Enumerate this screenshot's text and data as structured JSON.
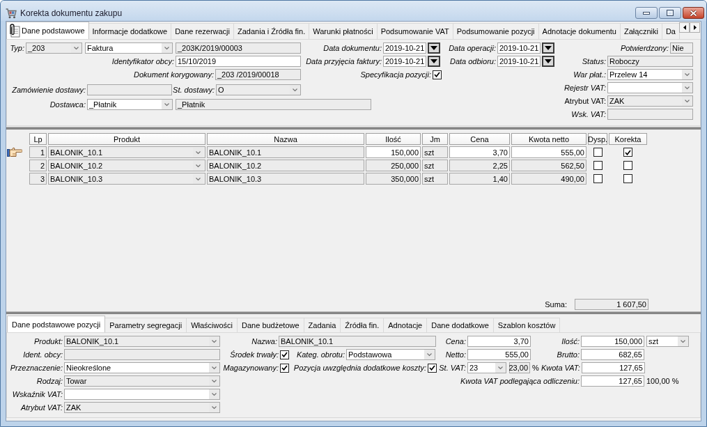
{
  "window": {
    "title": "Korekta dokumentu zakupu"
  },
  "tabs": [
    {
      "label": "Dane podstawowe",
      "selected": true
    },
    {
      "label": "Informacje dodatkowe",
      "selected": false
    },
    {
      "label": "Dane rezerwacji",
      "selected": false
    },
    {
      "label": "Zadania i Źródła fin.",
      "selected": false
    },
    {
      "label": "Warunki płatności",
      "selected": false
    },
    {
      "label": "Podsumowanie VAT",
      "selected": false
    },
    {
      "label": "Podsumowanie pozycji",
      "selected": false
    },
    {
      "label": "Adnotacje dokumentu",
      "selected": false
    },
    {
      "label": "Załączniki",
      "selected": false
    },
    {
      "label": "Da",
      "selected": false
    }
  ],
  "header": {
    "left": [
      [
        {
          "label": "Typ:",
          "italic": true,
          "kind": "combo",
          "value": "_203",
          "read_only": true
        },
        {
          "kind": "combo",
          "value": "Faktura",
          "read_only": false
        },
        {
          "kind": "text",
          "value": "_203K/2019/00003",
          "read_only": true
        }
      ],
      [
        {
          "label": "Identyfikator obcy:",
          "italic": true,
          "kind": "text",
          "value": "15/10/2019",
          "read_only": false
        }
      ],
      [
        {
          "label": "Dokument korygowany:",
          "italic": true,
          "kind": "text",
          "value": "_203 /2019/00018",
          "read_only": true
        }
      ],
      [
        {
          "label": "Zamówienie dostawy:",
          "italic": true,
          "kind": "text",
          "read_only": true
        },
        {
          "label": "St. dostawy:",
          "italic": true,
          "kind": "combo",
          "value": "O",
          "read_only": true
        }
      ],
      [
        {
          "label": "Dostawca:",
          "italic": true,
          "kind": "combo",
          "value": "_Płatnik",
          "read_only": false
        },
        {
          "kind": "text",
          "value": "_Płatnik",
          "read_only": true
        }
      ]
    ],
    "dates": [
      [
        {
          "label": "Data dokumentu:",
          "italic": true,
          "kind": "date",
          "value": "2019-10-21",
          "read_only": false
        },
        {
          "label": "Data operacji:",
          "italic": true,
          "kind": "date",
          "value": "2019-10-21",
          "read_only": false
        }
      ],
      [
        {
          "label": "Data przyjęcia faktury:",
          "italic": true,
          "kind": "date",
          "value": "2019-10-21",
          "read_only": false
        },
        {
          "label": "Data odbioru:",
          "italic": true,
          "kind": "date",
          "value": "2019-10-21",
          "read_only": false
        }
      ],
      [
        {
          "label": "Specyfikacja pozycji:",
          "italic": true,
          "kind": "check",
          "checked": true
        }
      ]
    ],
    "right": [
      {
        "label": "Potwierdzony:",
        "italic": true,
        "kind": "text",
        "value": "Nie",
        "read_only": true
      },
      {
        "label": "Status:",
        "italic": true,
        "kind": "text",
        "value": "Roboczy",
        "read_only": true
      },
      {
        "label": "War płat.:",
        "italic": true,
        "kind": "combo",
        "value": "Przelew 14",
        "read_only": false
      },
      {
        "label": "Rejestr VAT:",
        "italic": true,
        "kind": "combo",
        "read_only": false
      },
      {
        "label": "Atrybut VAT:",
        "italic": false,
        "kind": "combo",
        "value": "ZAK",
        "read_only": true
      },
      {
        "label": "Wsk. VAT:",
        "italic": true,
        "kind": "text",
        "read_only": true
      }
    ]
  },
  "table": {
    "columns": [
      "Lp",
      "Produkt",
      "Nazwa",
      "Ilość",
      "Jm",
      "Cena",
      "Kwota netto",
      "Dysp.",
      "Korekta"
    ],
    "rows": [
      {
        "selected": true,
        "lp": "1",
        "product": "BALONIK_10.1",
        "name": "BALONIK_10.1",
        "quantity": "150,000",
        "unit": "szt",
        "price": "3,70",
        "net_amount": "555,00",
        "dysp": false,
        "correction": true
      },
      {
        "selected": false,
        "lp": "2",
        "product": "BALONIK_10.2",
        "name": "BALONIK_10.2",
        "quantity": "250,000",
        "unit": "szt",
        "price": "2,25",
        "net_amount": "562,50",
        "dysp": false,
        "correction": false
      },
      {
        "selected": false,
        "lp": "3",
        "product": "BALONIK_10.3",
        "name": "BALONIK_10.3",
        "quantity": "350,000",
        "unit": "szt",
        "price": "1,40",
        "net_amount": "490,00",
        "dysp": false,
        "correction": false
      }
    ],
    "total_label": "Suma:",
    "total": "1 607,50"
  },
  "item_tabs": [
    {
      "label": "Dane podstawowe pozycji",
      "selected": true
    },
    {
      "label": "Parametry segregacji",
      "selected": false
    },
    {
      "label": "Właściwości",
      "selected": false
    },
    {
      "label": "Dane budżetowe",
      "selected": false
    },
    {
      "label": "Zadania",
      "selected": false
    },
    {
      "label": "Źródła fin.",
      "selected": false
    },
    {
      "label": "Adnotacje",
      "selected": false
    },
    {
      "label": "Dane dodatkowe",
      "selected": false
    },
    {
      "label": "Szablon kosztów",
      "selected": false
    }
  ],
  "item_form": {
    "left": [
      {
        "label": "Produkt:",
        "italic": true,
        "kind": "combo",
        "value": "BALONIK_10.1",
        "read_only": true
      },
      {
        "label": "Ident. obcy:",
        "italic": true,
        "kind": "text",
        "read_only": true
      },
      {
        "label": "Przeznaczenie:",
        "italic": true,
        "kind": "combo",
        "value": "Nieokreślone",
        "read_only": false
      },
      {
        "label": "Rodzaj:",
        "italic": true,
        "kind": "combo",
        "value": "Towar",
        "read_only": true
      },
      {
        "label": "Wskaźnik VAT:",
        "italic": true,
        "kind": "combo",
        "read_only": false
      },
      {
        "label": "Atrybut VAT:",
        "italic": true,
        "kind": "combo",
        "value": "ZAK",
        "read_only": true
      }
    ],
    "middle": [
      [
        {
          "label": "Nazwa:",
          "italic": true,
          "kind": "text",
          "value": "BALONIK_10.1",
          "read_only": true
        }
      ],
      [
        {
          "label": "Środek trwały:",
          "italic": true,
          "kind": "check",
          "checked": true
        },
        {
          "label": "Kateg. obrotu:",
          "italic": true,
          "kind": "combo",
          "value": "Podstawowa",
          "read_only": false
        }
      ],
      [
        {
          "label": "Magazynowany:",
          "italic": true,
          "kind": "check",
          "checked": true
        },
        {
          "label": "Pozycja uwzględnia dodatkowe koszty:",
          "italic": true,
          "kind": "check",
          "checked": true
        }
      ]
    ],
    "amounts": [
      [
        {
          "label": "Cena:",
          "italic": true,
          "kind": "number",
          "value": "3,70",
          "read_only": false
        },
        {
          "label": "Ilość:",
          "italic": true,
          "kind": "number",
          "value": "150,000",
          "read_only": false
        },
        {
          "kind": "combo",
          "value": "szt",
          "read_only": false
        }
      ],
      [
        {
          "label": "Netto:",
          "italic": true,
          "kind": "number",
          "value": "555,00",
          "read_only": false
        },
        {
          "label": "Brutto:",
          "italic": true,
          "kind": "number",
          "value": "682,65",
          "read_only": false
        }
      ],
      [
        {
          "label": "St. VAT:",
          "italic": true,
          "kind": "combo",
          "value": "23",
          "read_only": false
        },
        {
          "kind": "number",
          "value": "23,00",
          "read_only": true,
          "suffix": "%"
        },
        {
          "label": "Kwota VAT:",
          "italic": true,
          "kind": "number",
          "value": "127,65",
          "read_only": false
        }
      ],
      [
        {
          "label": "Kwota VAT podlegająca odliczeniu:",
          "italic": true,
          "kind": "number",
          "value": "127,65",
          "read_only": false,
          "suffix": "100,00 %"
        }
      ]
    ]
  }
}
